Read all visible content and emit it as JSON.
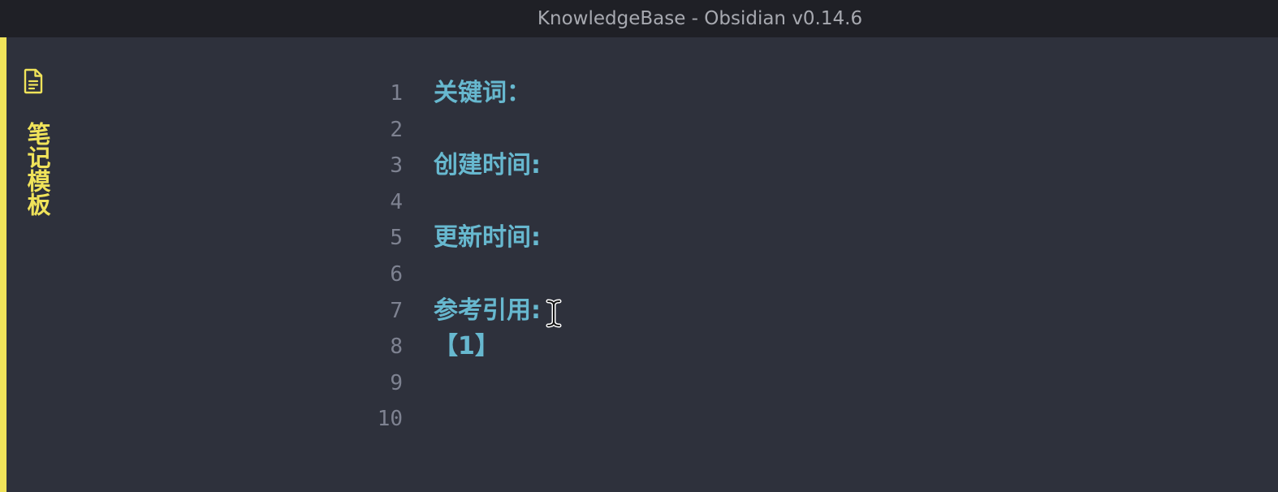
{
  "window": {
    "title": "KnowledgeBase - Obsidian v0.14.6"
  },
  "sidebar": {
    "tab_icon": "document-icon",
    "tab_label": "笔记模板",
    "accent_color": "#f0e35a"
  },
  "editor": {
    "text_color": "#67b8cf",
    "lines": [
      {
        "number": "1",
        "text": "关键词："
      },
      {
        "number": "2",
        "text": ""
      },
      {
        "number": "3",
        "text": "创建时间:"
      },
      {
        "number": "4",
        "text": ""
      },
      {
        "number": "5",
        "text": "更新时间:"
      },
      {
        "number": "6",
        "text": ""
      },
      {
        "number": "7",
        "text": "参考引用:"
      },
      {
        "number": "8",
        "text": "【1】"
      },
      {
        "number": "9",
        "text": ""
      },
      {
        "number": "10",
        "text": ""
      }
    ]
  },
  "pointer": {
    "icon": "text-cursor-icon"
  }
}
